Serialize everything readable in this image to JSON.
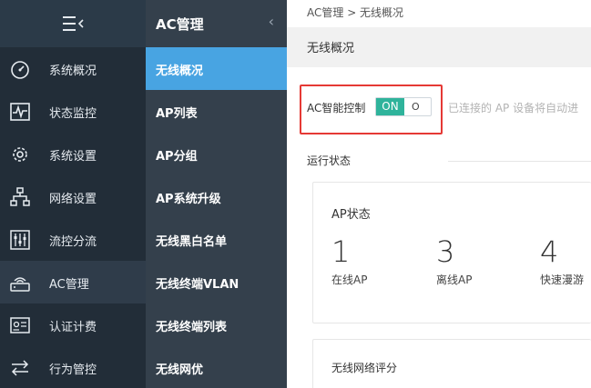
{
  "sidebar": {
    "items": [
      {
        "label": "系统概况",
        "icon": "dashboard-icon"
      },
      {
        "label": "状态监控",
        "icon": "pulse-icon"
      },
      {
        "label": "系统设置",
        "icon": "gear-icon"
      },
      {
        "label": "网络设置",
        "icon": "network-icon"
      },
      {
        "label": "流控分流",
        "icon": "sliders-icon"
      },
      {
        "label": "AC管理",
        "icon": "router-icon"
      },
      {
        "label": "认证计费",
        "icon": "id-card-icon"
      },
      {
        "label": "行为管控",
        "icon": "arrows-exchange-icon"
      }
    ]
  },
  "subnav": {
    "title": "AC管理",
    "items": [
      {
        "label": "无线概况"
      },
      {
        "label": "AP列表"
      },
      {
        "label": "AP分组"
      },
      {
        "label": "AP系统升级"
      },
      {
        "label": "无线黑白名单"
      },
      {
        "label": "无线终端VLAN"
      },
      {
        "label": "无线终端列表"
      },
      {
        "label": "无线网优"
      }
    ]
  },
  "main": {
    "breadcrumb": "AC管理 > 无线概况",
    "page_title": "无线概况",
    "ac_control_label": "AC智能控制",
    "toggle_on": "ON",
    "toggle_off": "O",
    "hint": "已连接的 AP 设备将自动进",
    "section_label": "运行状态",
    "ap_status": {
      "title": "AP状态",
      "stats": [
        {
          "value": "1",
          "caption": "在线AP"
        },
        {
          "value": "3",
          "caption": "离线AP"
        },
        {
          "value": "4",
          "caption": "快速漫游"
        }
      ]
    },
    "wifi_score_title": "无线网络评分"
  },
  "colors": {
    "sidebar_bg": "#222d38",
    "subnav_bg": "#34404c",
    "active_blue": "#48a4e2",
    "toggle_green": "#2fb39b",
    "highlight_red": "#e53935"
  }
}
